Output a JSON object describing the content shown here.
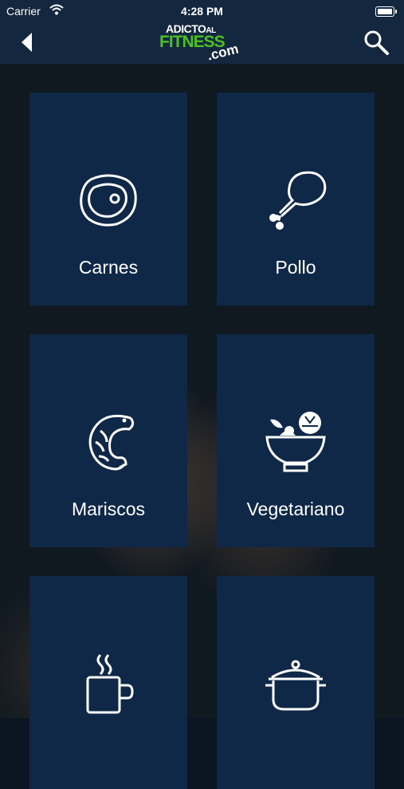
{
  "status_bar": {
    "carrier": "Carrier",
    "time": "4:28 PM"
  },
  "header": {
    "logo_line1": "ADICTO",
    "logo_al": "AL",
    "logo_line2": "FITNESS",
    "logo_line3": ".com"
  },
  "categories": [
    {
      "label": "Carnes",
      "icon": "meat-steak-icon"
    },
    {
      "label": "Pollo",
      "icon": "chicken-leg-icon"
    },
    {
      "label": "Mariscos",
      "icon": "shrimp-icon"
    },
    {
      "label": "Vegetariano",
      "icon": "salad-bowl-icon"
    },
    {
      "label": "",
      "icon": "coffee-mug-icon"
    },
    {
      "label": "",
      "icon": "cooking-pot-icon"
    }
  ],
  "colors": {
    "bar": "#13283e",
    "tile": "#0f2847",
    "logo_green": "#4bc024"
  }
}
